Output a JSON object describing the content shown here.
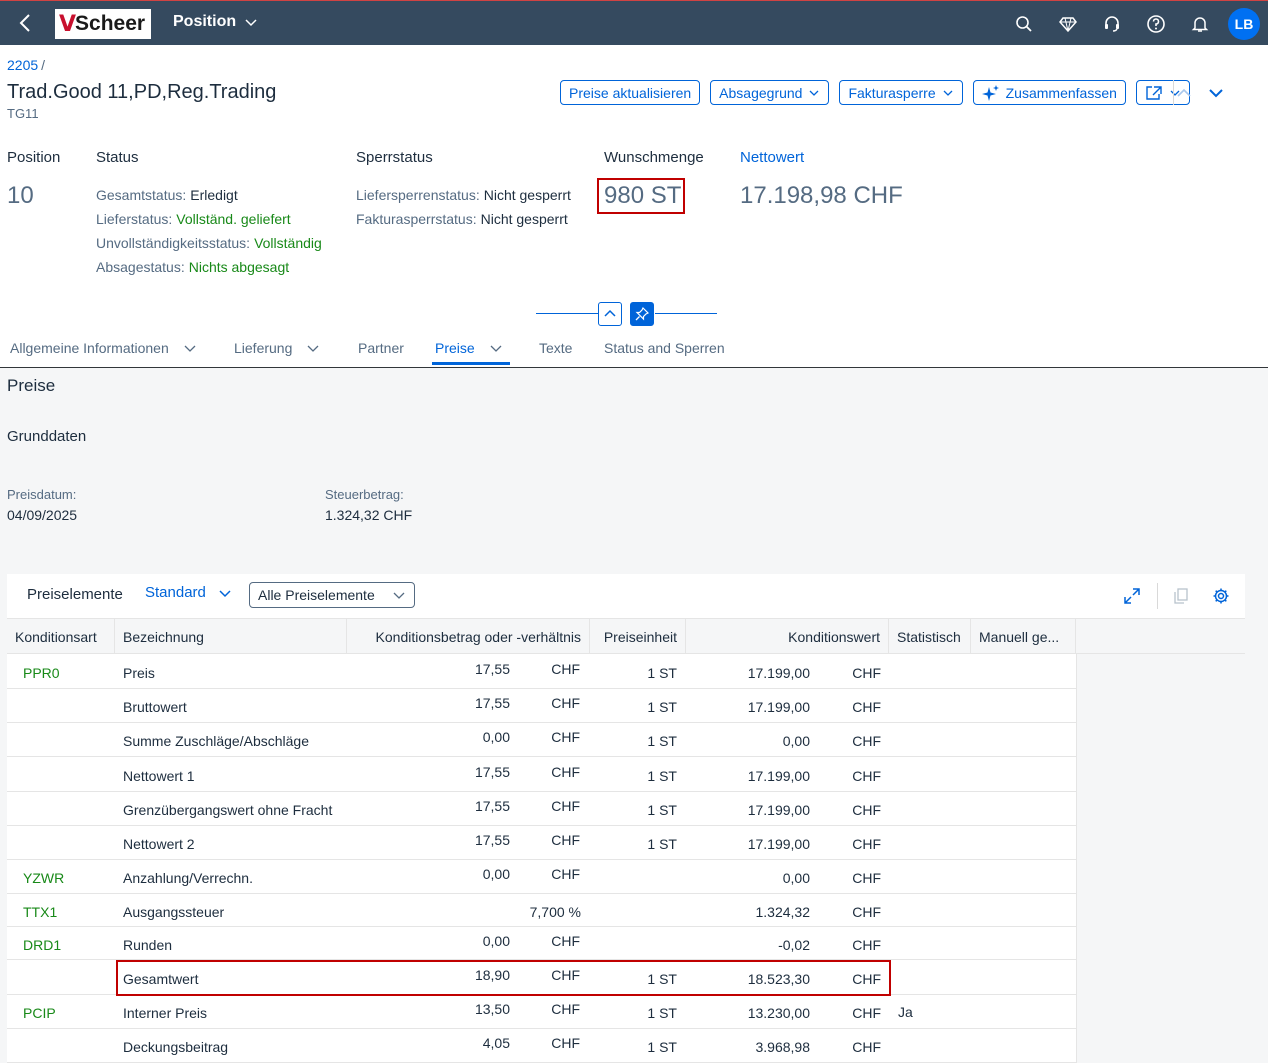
{
  "shell": {
    "logo_text": "Scheer",
    "app_title": "Position",
    "avatar_initials": "LB"
  },
  "header": {
    "breadcrumb": "2205",
    "breadcrumb_sep": "/",
    "title": "Trad.Good 11,PD,Reg.Trading",
    "subtitle": "TG11",
    "actions": {
      "update_prices": "Preise aktualisieren",
      "rejection_reason": "Absagegrund",
      "billing_block": "Fakturasperre",
      "summarize": "Zusammenfassen"
    }
  },
  "kpis": {
    "position_label": "Position",
    "position_value": "10",
    "status_label": "Status",
    "overall_status_label": "Gesamtstatus:",
    "overall_status_value": "Erledigt",
    "delivery_status_label": "Lieferstatus:",
    "delivery_status_value": "Vollständ. geliefert",
    "completeness_label": "Unvollständigkeitsstatus:",
    "completeness_value": "Vollständig",
    "rejection_status_label": "Absagestatus:",
    "rejection_status_value": "Nichts abgesagt",
    "block_label": "Sperrstatus",
    "delivery_block_label": "Liefersperrenstatus:",
    "delivery_block_value": "Nicht gesperrt",
    "billing_block_label": "Fakturasperrstatus:",
    "billing_block_value": "Nicht gesperrt",
    "qty_label": "Wunschmenge",
    "qty_value": "980 ST",
    "net_label": "Nettowert",
    "net_value": "17.198,98 CHF"
  },
  "tabs": [
    {
      "label": "Allgemeine Informationen"
    },
    {
      "label": "Lieferung"
    },
    {
      "label": "Partner"
    },
    {
      "label": "Preise"
    },
    {
      "label": "Texte"
    },
    {
      "label": "Status and Sperren"
    }
  ],
  "section": {
    "title": "Preise",
    "subtitle": "Grunddaten",
    "price_date_label": "Preisdatum:",
    "price_date_value": "04/09/2025",
    "tax_label": "Steuerbetrag:",
    "tax_value": "1.324,32 CHF"
  },
  "table": {
    "title": "Preiselemente",
    "variant": "Standard",
    "filter": "Alle Preiselemente",
    "columns": [
      "Konditionsart",
      "Bezeichnung",
      "Konditionsbetrag oder -verhältnis",
      "Preiseinheit",
      "Konditionswert",
      "Statistisch",
      "Manuell ge..."
    ],
    "rows": [
      {
        "type": "PPR0",
        "name": "Preis",
        "amount": "17,55",
        "amount_cur": "CHF",
        "unit": "1 ST",
        "value": "17.199,00",
        "value_cur": "CHF",
        "stat": ""
      },
      {
        "type": "",
        "name": "Bruttowert",
        "amount": "17,55",
        "amount_cur": "CHF",
        "unit": "1 ST",
        "value": "17.199,00",
        "value_cur": "CHF",
        "stat": ""
      },
      {
        "type": "",
        "name": "Summe Zuschläge/Abschläge",
        "amount": "0,00",
        "amount_cur": "CHF",
        "unit": "1 ST",
        "value": "0,00",
        "value_cur": "CHF",
        "stat": ""
      },
      {
        "type": "",
        "name": "Nettowert 1",
        "amount": "17,55",
        "amount_cur": "CHF",
        "unit": "1 ST",
        "value": "17.199,00",
        "value_cur": "CHF",
        "stat": ""
      },
      {
        "type": "",
        "name": "Grenzübergangswert ohne Fracht",
        "amount": "17,55",
        "amount_cur": "CHF",
        "unit": "1 ST",
        "value": "17.199,00",
        "value_cur": "CHF",
        "stat": ""
      },
      {
        "type": "",
        "name": "Nettowert 2",
        "amount": "17,55",
        "amount_cur": "CHF",
        "unit": "1 ST",
        "value": "17.199,00",
        "value_cur": "CHF",
        "stat": ""
      },
      {
        "type": "YZWR",
        "name": "Anzahlung/Verrechn.",
        "amount": "0,00",
        "amount_cur": "CHF",
        "unit": "",
        "value": "0,00",
        "value_cur": "CHF",
        "stat": ""
      },
      {
        "type": "TTX1",
        "name": "Ausgangssteuer",
        "amount": "7,700 %",
        "amount_cur": "",
        "unit": "",
        "value": "1.324,32",
        "value_cur": "CHF",
        "stat": ""
      },
      {
        "type": "DRD1",
        "name": "Runden",
        "amount": "0,00",
        "amount_cur": "CHF",
        "unit": "",
        "value": "-0,02",
        "value_cur": "CHF",
        "stat": ""
      },
      {
        "type": "",
        "name": "Gesamtwert",
        "amount": "18,90",
        "amount_cur": "CHF",
        "unit": "1 ST",
        "value": "18.523,30",
        "value_cur": "CHF",
        "stat": ""
      },
      {
        "type": "PCIP",
        "name": "Interner Preis",
        "amount": "13,50",
        "amount_cur": "CHF",
        "unit": "1 ST",
        "value": "13.230,00",
        "value_cur": "CHF",
        "stat": "Ja"
      },
      {
        "type": "",
        "name": "Deckungsbeitrag",
        "amount": "4,05",
        "amount_cur": "CHF",
        "unit": "1 ST",
        "value": "3.968,98",
        "value_cur": "CHF",
        "stat": ""
      }
    ]
  },
  "colors": {
    "shell_bg": "#354a5f",
    "accent": "#0064d9",
    "positive": "#188918",
    "highlight": "#c00000"
  }
}
